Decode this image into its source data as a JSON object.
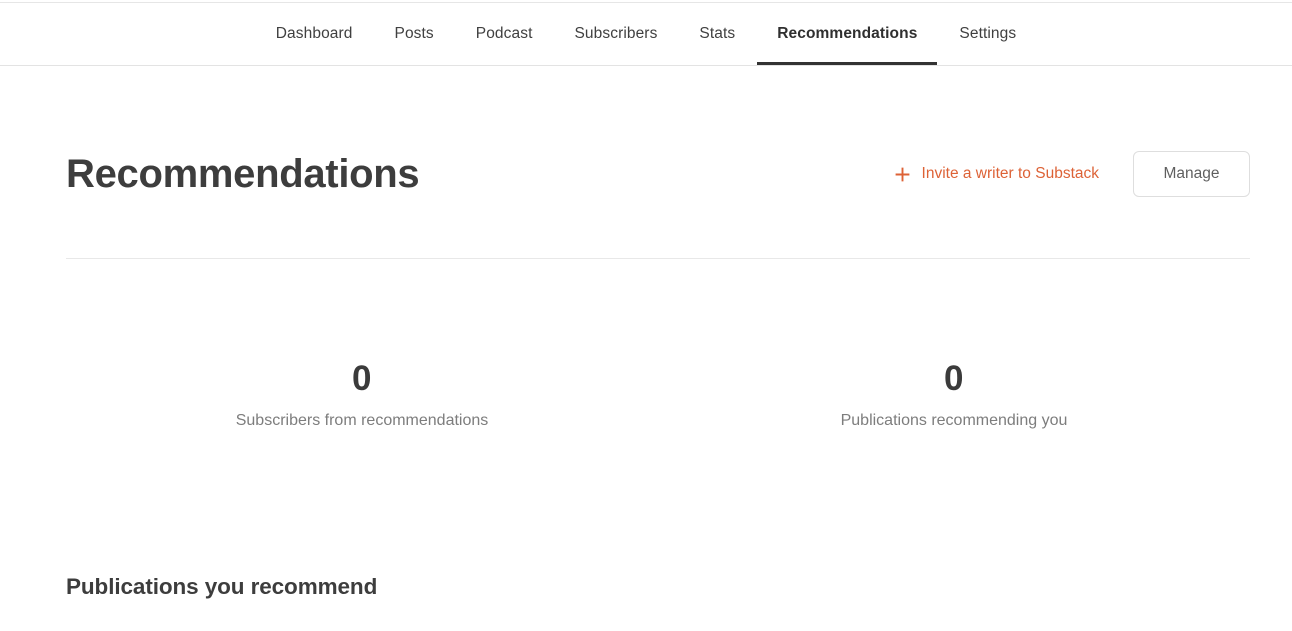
{
  "nav": {
    "items": [
      {
        "label": "Dashboard",
        "active": false
      },
      {
        "label": "Posts",
        "active": false
      },
      {
        "label": "Podcast",
        "active": false
      },
      {
        "label": "Subscribers",
        "active": false
      },
      {
        "label": "Stats",
        "active": false
      },
      {
        "label": "Recommendations",
        "active": true
      },
      {
        "label": "Settings",
        "active": false
      }
    ]
  },
  "header": {
    "title": "Recommendations",
    "invite_label": "Invite a writer to Substack",
    "invite_icon": "plus-icon",
    "manage_label": "Manage"
  },
  "stats": [
    {
      "value": "0",
      "label": "Subscribers from recommendations"
    },
    {
      "value": "0",
      "label": "Publications recommending you"
    }
  ],
  "sections": {
    "publications_you_recommend_heading": "Publications you recommend"
  },
  "colors": {
    "accent_orange": "#dd6236",
    "text_dark": "#3d3d3d",
    "text_muted": "#7d7d7d",
    "border_light": "#e3e3e3",
    "active_underline": "#333333"
  }
}
